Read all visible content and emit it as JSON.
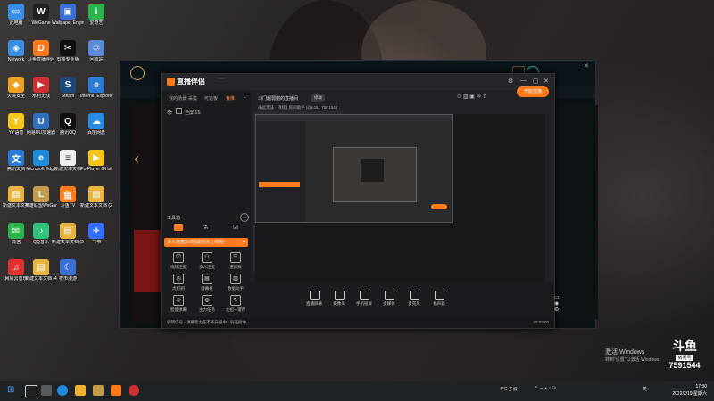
{
  "desktop": {
    "icons": [
      {
        "label": "此电脑",
        "color": "#3a8ee6",
        "glyph": "▭"
      },
      {
        "label": "WeGame",
        "color": "#222",
        "glyph": "W"
      },
      {
        "label": "Wallpaper Engine:...",
        "color": "#3a6fd6",
        "glyph": "▣"
      },
      {
        "label": "爱奇艺",
        "color": "#2bb44b",
        "glyph": "i"
      },
      {
        "label": "Network",
        "color": "#3a8ee6",
        "glyph": "◈"
      },
      {
        "label": "斗鱼直播伴侣",
        "color": "#ff7a1a",
        "glyph": "D"
      },
      {
        "label": "剪映专业版",
        "color": "#111",
        "glyph": "✂"
      },
      {
        "label": "回收站",
        "color": "#5a8ad6",
        "glyph": "♲"
      },
      {
        "label": "火绒安全",
        "color": "#f0a020",
        "glyph": "◆"
      },
      {
        "label": "水利无线",
        "color": "#d03030",
        "glyph": "▶"
      },
      {
        "label": "Steam",
        "color": "#1b4a7a",
        "glyph": "S"
      },
      {
        "label": "Internet Explorer",
        "color": "#2a7ad6",
        "glyph": "e"
      },
      {
        "label": "YY语音",
        "color": "#f5c518",
        "glyph": "Y"
      },
      {
        "label": "网易UU加速器",
        "color": "#3070c0",
        "glyph": "U"
      },
      {
        "label": "腾讯QQ",
        "color": "#111",
        "glyph": "Q"
      },
      {
        "label": "百度网盘",
        "color": "#2a8ae6",
        "glyph": "☁"
      },
      {
        "label": "腾讯文档",
        "color": "#2a7ad6",
        "glyph": "文"
      },
      {
        "label": "Microsoft Edge",
        "color": "#1d8adb",
        "glyph": "e"
      },
      {
        "label": "新建文本文档",
        "color": "#eeeeee",
        "glyph": "≡"
      },
      {
        "label": "PotPlayer 64 bit",
        "color": "#f5c518",
        "glyph": "▶"
      },
      {
        "label": "新建文本文档",
        "color": "#e8b540",
        "glyph": "▤"
      },
      {
        "label": "英雄联盟WeGame版",
        "color": "#c39b4a",
        "glyph": "L"
      },
      {
        "label": "斗鱼TV",
        "color": "#ff7a1a",
        "glyph": "鱼"
      },
      {
        "label": "新建文本文档 (2)",
        "color": "#e8b540",
        "glyph": "▤"
      },
      {
        "label": "微信",
        "color": "#2bb44b",
        "glyph": "✉"
      },
      {
        "label": "QQ音乐",
        "color": "#31c27c",
        "glyph": "♪"
      },
      {
        "label": "新建文本文档 (3)",
        "color": "#e8b540",
        "glyph": "▤"
      },
      {
        "label": "飞书",
        "color": "#3370ff",
        "glyph": "✈"
      },
      {
        "label": "网易云音乐",
        "color": "#e03030",
        "glyph": "♫"
      },
      {
        "label": "新建文本文档 (4)",
        "color": "#e8b540",
        "glyph": "▤"
      },
      {
        "label": "夜市漫游",
        "color": "#3a6fd6",
        "glyph": "☾"
      }
    ]
  },
  "app": {
    "name": "直播伴侣",
    "version": "",
    "tabs": [
      "我的场景",
      "采集",
      "可选板",
      "我推"
    ],
    "source_row": "全屏 1S",
    "tools_title": "工具箱",
    "promo": "多人连麦2v2团战对决上线啦~",
    "tools": [
      {
        "label": "视频连麦",
        "glyph": "⎚"
      },
      {
        "label": "多人连麦",
        "glyph": "⚇"
      },
      {
        "label": "道具赛",
        "glyph": "☰"
      },
      {
        "label": "虎灯刷",
        "glyph": "◷"
      },
      {
        "label": "弹幕板",
        "glyph": "▤"
      },
      {
        "label": "数据助手",
        "glyph": "▥"
      },
      {
        "label": "智能弹幕",
        "glyph": "◎"
      },
      {
        "label": "主力任务",
        "glyph": "◍"
      },
      {
        "label": "大招一键用",
        "glyph": "↻"
      }
    ],
    "room_title": "斗门超弱鲍的直播间",
    "room_edit": "修改",
    "room_sub": "永远无法 · 持续  |  房间助手 (@LOL)  75P1544",
    "bottom": [
      {
        "label": "直播屏幕"
      },
      {
        "label": "摄像头"
      },
      {
        "label": "手机投屏"
      },
      {
        "label": "多媒体"
      },
      {
        "label": "麦克风"
      },
      {
        "label": "扬声器"
      }
    ],
    "start_label": "开始直播",
    "status": "弱网信号  -  弹幕能力在不断升级中  -  弱连接中",
    "status_right": "00:00:00"
  },
  "watermark": {
    "activate_line1": "激活 Windows",
    "activate_line2": "转到\"设置\"以激活 Windows",
    "douyu_logo": "斗鱼",
    "douyu_room_label": "房间号",
    "douyu_room": "7591544"
  },
  "taskbar": {
    "weather": "4°C 多云",
    "lang": "英",
    "time": "17:30",
    "date": "2022/2/19 星期六"
  }
}
